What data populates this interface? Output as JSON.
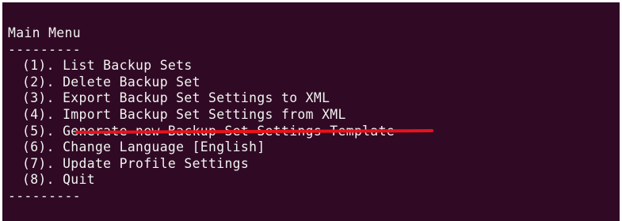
{
  "menu": {
    "title": "Main Menu",
    "separator_top": "---------",
    "items": [
      {
        "number": "(1).",
        "label": "List Backup Sets"
      },
      {
        "number": "(2).",
        "label": "Delete Backup Set"
      },
      {
        "number": "(3).",
        "label": "Export Backup Set Settings to XML"
      },
      {
        "number": "(4).",
        "label": "Import Backup Set Settings from XML"
      },
      {
        "number": "(5).",
        "label": "Generate new Backup Set Settings Template"
      },
      {
        "number": "(6).",
        "label": "Change Language [English]"
      },
      {
        "number": "(7).",
        "label": "Update Profile Settings"
      },
      {
        "number": "(8).",
        "label": "Quit"
      }
    ],
    "separator_bottom": "---------"
  },
  "colors": {
    "terminal_background": "#300a24",
    "text": "#f2f2f2",
    "highlight_underline": "#e8131b"
  }
}
